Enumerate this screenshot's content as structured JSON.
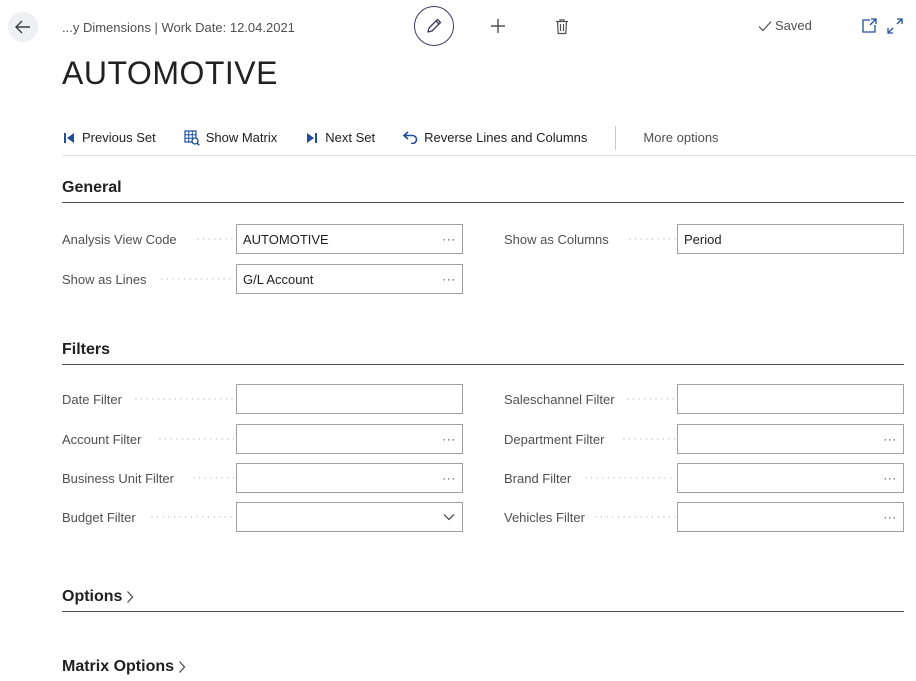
{
  "header": {
    "breadcrumb": "...y Dimensions | Work Date: 12.04.2021",
    "saved_label": "Saved",
    "title": "AUTOMOTIVE"
  },
  "actions": {
    "previous_set": "Previous Set",
    "show_matrix": "Show Matrix",
    "next_set": "Next Set",
    "reverse": "Reverse Lines and Columns",
    "more_options": "More options"
  },
  "general": {
    "title": "General",
    "analysis_view_code": {
      "label": "Analysis View Code",
      "value": "AUTOMOTIVE"
    },
    "show_as_lines": {
      "label": "Show as Lines",
      "value": "G/L Account"
    },
    "show_as_columns": {
      "label": "Show as Columns",
      "value": "Period"
    }
  },
  "filters": {
    "title": "Filters",
    "date_filter": {
      "label": "Date Filter",
      "value": ""
    },
    "account_filter": {
      "label": "Account Filter",
      "value": ""
    },
    "business_unit_filter": {
      "label": "Business Unit Filter",
      "value": ""
    },
    "budget_filter": {
      "label": "Budget Filter",
      "value": ""
    },
    "saleschannel_filter": {
      "label": "Saleschannel Filter",
      "value": ""
    },
    "department_filter": {
      "label": "Department Filter",
      "value": ""
    },
    "brand_filter": {
      "label": "Brand Filter",
      "value": ""
    },
    "vehicles_filter": {
      "label": "Vehicles Filter",
      "value": ""
    }
  },
  "sections": {
    "options": "Options",
    "matrix_options": "Matrix Options"
  },
  "colors": {
    "accent": "#0f6fc6",
    "action_icon": "#1f4e9c",
    "text": "#212121",
    "muted": "#505050"
  },
  "icons": {
    "back": "arrow-left-icon",
    "edit": "pencil-icon",
    "new": "plus-icon",
    "delete": "trash-icon",
    "saved": "checkmark-icon",
    "open_new": "open-in-new-window-icon",
    "expand": "expand-icon",
    "previous_set": "previous-set-icon",
    "show_matrix": "matrix-icon",
    "next_set": "next-set-icon",
    "reverse": "undo-arrow-icon"
  }
}
